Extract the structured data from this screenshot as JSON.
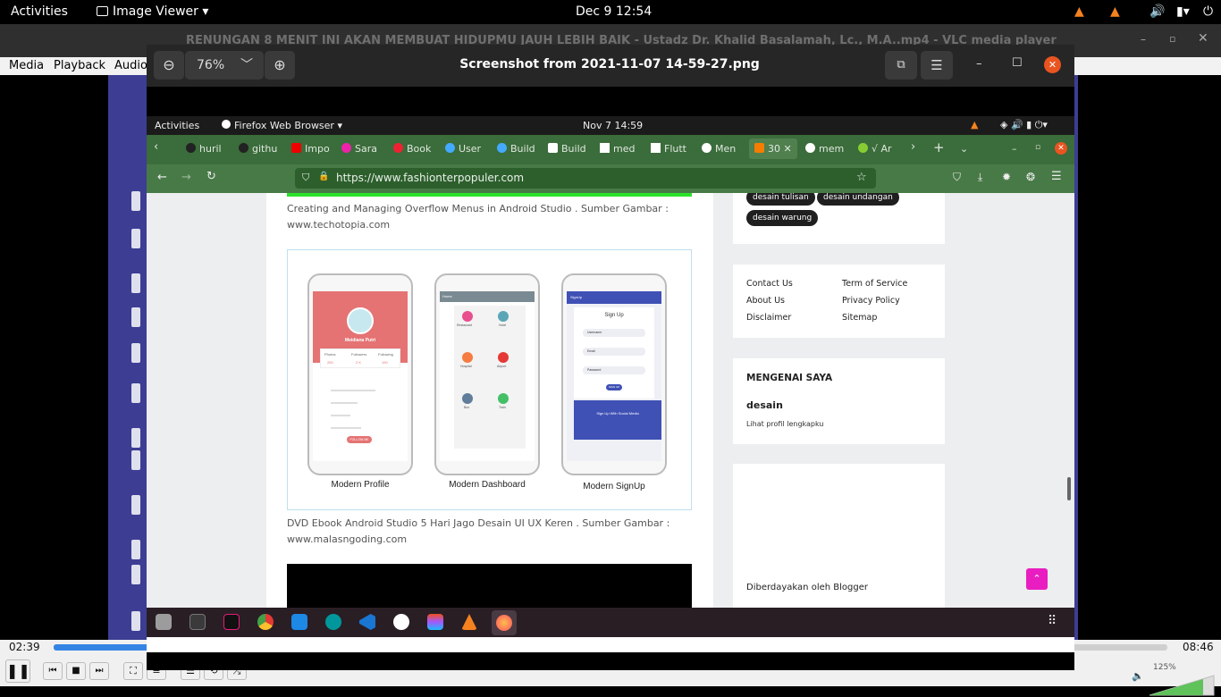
{
  "gnome_bar": {
    "activities": "Activities",
    "app": "Image Viewer",
    "clock": "Dec 9  12:54"
  },
  "vlc": {
    "title": "RENUNGAN 8 MENIT INI AKAN MEMBUAT HIDUPMU JAUH LEBIH BAIK - Ustadz Dr. Khalid Basalamah, Lc., M.A..mp4 - VLC media player",
    "menu": [
      "Media",
      "Playback",
      "Audio"
    ],
    "time_elapsed": "02:39",
    "time_total": "08:46",
    "progress": 0.303,
    "volume": "125%"
  },
  "image_viewer": {
    "zoom": "76%",
    "title": "Screenshot from 2021-11-07 14-59-27.png"
  },
  "shot": {
    "top": {
      "activities": "Activities",
      "app": "Firefox Web Browser",
      "clock": "Nov 7  14:59"
    },
    "tabs": [
      "huril",
      "githu",
      "Impo",
      "Sara",
      "Book",
      "User",
      "Build",
      "Build",
      "med",
      "Flutt",
      "Men",
      "30",
      "mem",
      "√ Ar"
    ],
    "url": "https://www.fashionterpopuler.com",
    "caption1": "Creating and Managing Overflow Menus in Android Studio . Sumber Gambar : www.techotopia.com",
    "caption2": "DVD Ebook Android Studio 5 Hari Jago Desain UI UX Keren . Sumber Gambar : www.malasngoding.com",
    "phones": {
      "profile": {
        "label": "Modern Profile",
        "name": "Meidiana Putri",
        "stats": [
          "Photos",
          "Followers",
          "Following"
        ],
        "values": [
          "250",
          "2 K",
          "190"
        ],
        "button": "FOLLOW ME"
      },
      "dashboard": {
        "label": "Modern Dashboard",
        "header": "Home",
        "items": [
          "Restaurant",
          "Hotel",
          "Hospital",
          "Airport",
          "Bus",
          "Train"
        ]
      },
      "signup": {
        "label": "Modern SignUp",
        "header": "SignUp",
        "title": "Sign Up",
        "fields": [
          "Username",
          "Email",
          "Password"
        ],
        "button": "SIGN UP",
        "social": "Sign Up With Social Media"
      }
    },
    "sidebar": {
      "tags": [
        "desain tulisan",
        "desain undangan",
        "desain warung"
      ],
      "links": [
        "Contact Us",
        "Term of Service",
        "About Us",
        "Privacy Policy",
        "Disclaimer",
        "Sitemap"
      ],
      "about_title": "MENGENAI SAYA",
      "about_name": "desain",
      "about_link": "Lihat profil lengkapku",
      "powered": "Diberdayakan oleh Blogger"
    }
  }
}
